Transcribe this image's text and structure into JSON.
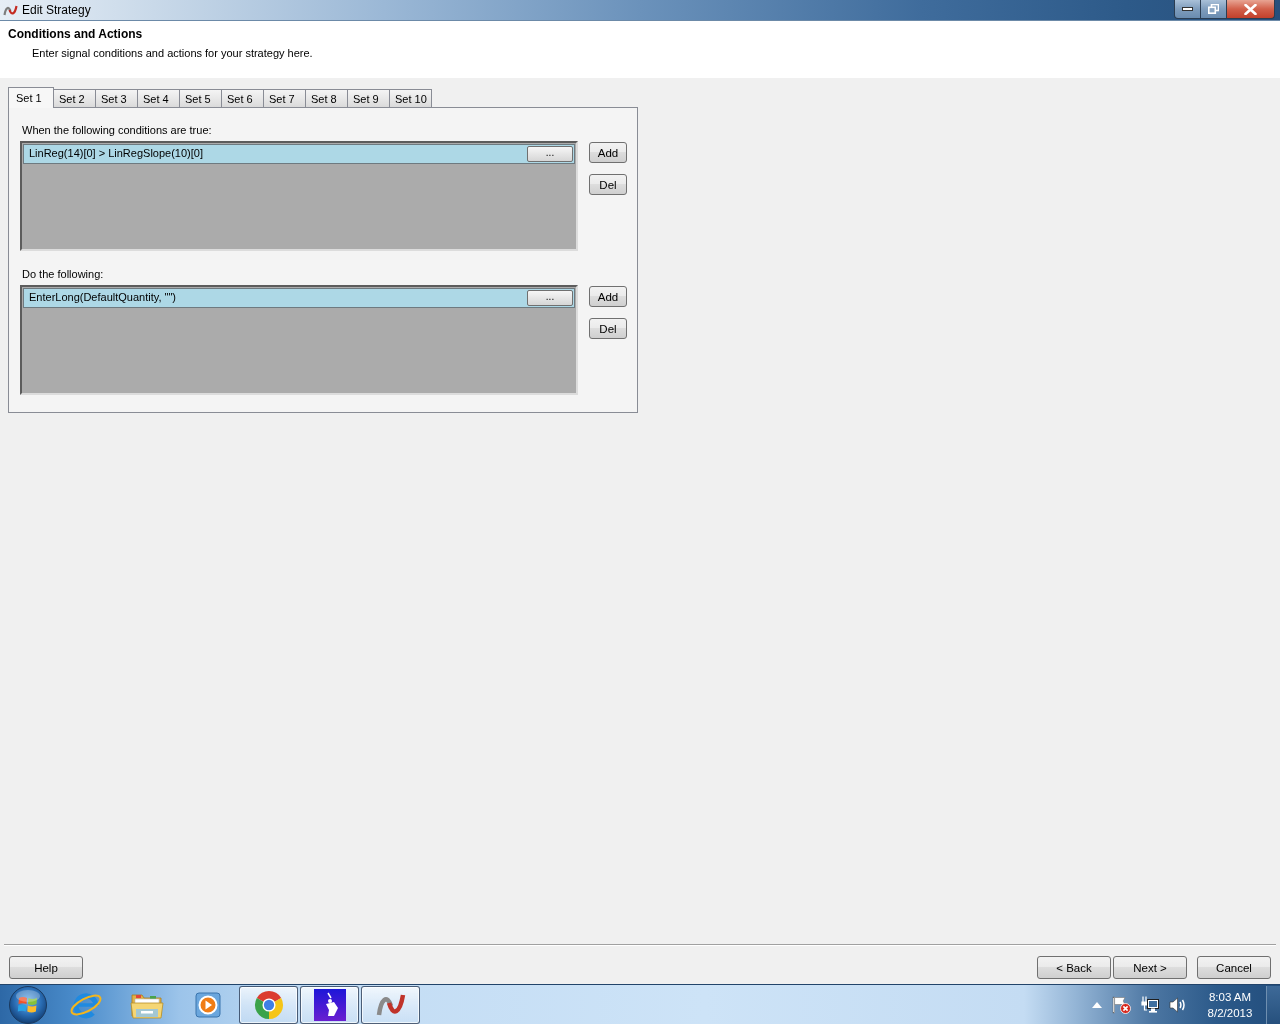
{
  "window": {
    "title": "Edit Strategy"
  },
  "header": {
    "title": "Conditions and Actions",
    "subtitle": "Enter signal conditions and actions for your strategy here."
  },
  "tabs": [
    {
      "label": "Set 1",
      "selected": true
    },
    {
      "label": "Set 2",
      "selected": false
    },
    {
      "label": "Set 3",
      "selected": false
    },
    {
      "label": "Set 4",
      "selected": false
    },
    {
      "label": "Set 5",
      "selected": false
    },
    {
      "label": "Set 6",
      "selected": false
    },
    {
      "label": "Set 7",
      "selected": false
    },
    {
      "label": "Set 8",
      "selected": false
    },
    {
      "label": "Set 9",
      "selected": false
    },
    {
      "label": "Set 10",
      "selected": false
    }
  ],
  "sections": [
    {
      "label": "When the following conditions are true:",
      "rows": [
        {
          "text": "LinReg(14)[0] > LinRegSlope(10)[0]",
          "button": "...",
          "selected": true
        }
      ],
      "buttons": [
        "Add",
        "Del"
      ]
    },
    {
      "label": "Do the following:",
      "rows": [
        {
          "text": "EnterLong(DefaultQuantity, \"\")",
          "button": "...",
          "selected": true
        }
      ],
      "buttons": [
        "Add",
        "Del"
      ]
    }
  ],
  "footer": {
    "left_buttons": [
      "Help"
    ],
    "right_buttons": [
      "< Back",
      "Next >",
      "Cancel"
    ]
  },
  "taskbar": {
    "apps": [
      {
        "kind": "ebrowser",
        "running": false
      },
      {
        "kind": "folder",
        "running": false
      },
      {
        "kind": "player",
        "running": false
      },
      {
        "kind": "wheel",
        "running": true
      },
      {
        "kind": "tile",
        "running": true
      },
      {
        "kind": "swoosh",
        "running": true
      }
    ],
    "clock": {
      "time": "8:03 AM",
      "date": "8/2/2013"
    }
  }
}
